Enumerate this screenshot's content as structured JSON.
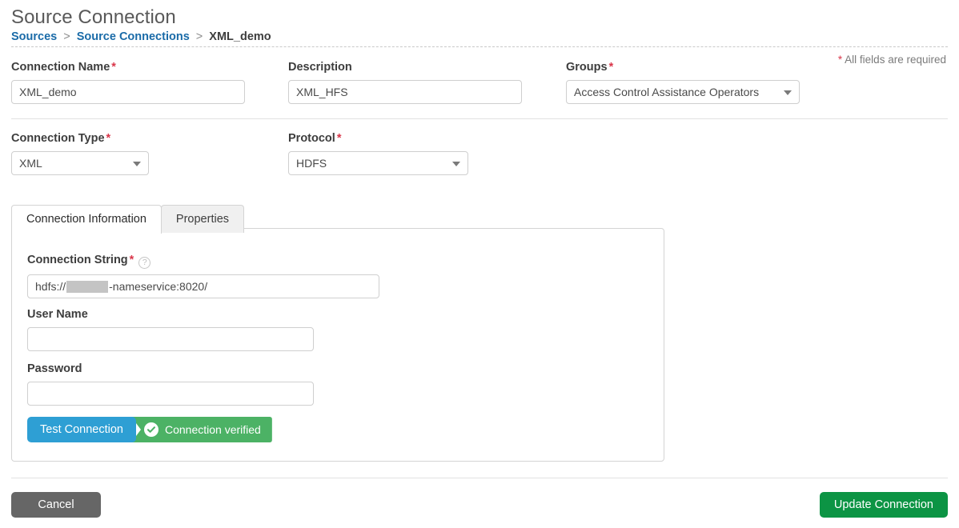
{
  "header": {
    "title": "Source Connection",
    "breadcrumb": {
      "root": "Sources",
      "separator": ">",
      "parent": "Source Connections",
      "current": "XML_demo"
    },
    "required_note_star": "*",
    "required_note_text": "All fields are required"
  },
  "form": {
    "connection_name": {
      "label": "Connection Name",
      "required_marker": "*",
      "value": "XML_demo",
      "placeholder": ""
    },
    "description": {
      "label": "Description",
      "required_marker": "",
      "value": "XML_HFS",
      "placeholder": ""
    },
    "groups": {
      "label": "Groups",
      "required_marker": "*",
      "value": "Access Control Assistance Operators",
      "caret_icon": "chevron-down-icon"
    },
    "connection_type": {
      "label": "Connection Type",
      "required_marker": "*",
      "value": "XML",
      "caret_icon": "chevron-down-icon"
    },
    "protocol": {
      "label": "Protocol",
      "required_marker": "*",
      "value": "HDFS",
      "caret_icon": "chevron-down-icon"
    }
  },
  "tabs": [
    {
      "label": "Connection Information",
      "active": true
    },
    {
      "label": "Properties",
      "active": false
    }
  ],
  "panel": {
    "connection_string": {
      "label": "Connection String",
      "required_marker": "*",
      "help_icon": "help-circle-icon",
      "help_glyph": "?",
      "prefix": "hdfs://",
      "redacted": true,
      "suffix": "-nameservice:8020/"
    },
    "user_name": {
      "label": "User Name",
      "value": "",
      "placeholder": ""
    },
    "password": {
      "label": "Password",
      "value": "",
      "placeholder": ""
    },
    "test_connection_label": "Test Connection",
    "verified_label": "Connection verified",
    "verified_icon": "check-circle-icon"
  },
  "footer": {
    "cancel_label": "Cancel",
    "update_label": "Update Connection"
  },
  "colors": {
    "link": "#1a6ba8",
    "required_star": "#d9364a",
    "test_button": "#2e9fd4",
    "verified_badge": "#4cb265",
    "update_button": "#0c9444",
    "cancel_button": "#666666",
    "redaction": "#c4c4c4"
  }
}
